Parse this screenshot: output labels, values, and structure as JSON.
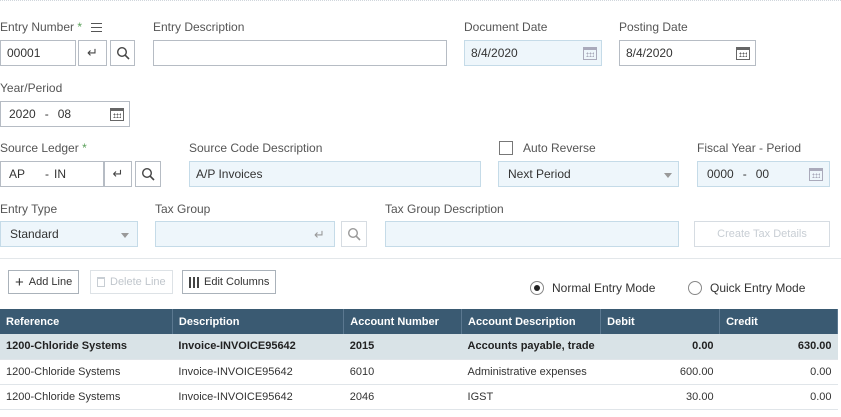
{
  "header_form": {
    "entry_number": {
      "label": "Entry Number",
      "required": "*",
      "value": "00001"
    },
    "entry_description": {
      "label": "Entry Description",
      "value": ""
    },
    "document_date": {
      "label": "Document Date",
      "value": "8/4/2020"
    },
    "posting_date": {
      "label": "Posting Date",
      "value": "8/4/2020"
    },
    "year_period": {
      "label": "Year/Period",
      "year": "2020",
      "sep": "-",
      "period": "08"
    },
    "source_ledger": {
      "label": "Source Ledger",
      "required": "*",
      "ledger": "AP",
      "sep": "-",
      "code": "IN"
    },
    "source_code_description": {
      "label": "Source Code Description",
      "value": "A/P Invoices"
    },
    "auto_reverse": {
      "label": "Auto Reverse",
      "checked": false,
      "option": "Next Period"
    },
    "fiscal_year_period": {
      "label": "Fiscal Year - Period",
      "year": "0000",
      "sep": "-",
      "period": "00"
    },
    "entry_type": {
      "label": "Entry Type",
      "value": "Standard"
    },
    "tax_group": {
      "label": "Tax Group",
      "value": ""
    },
    "tax_group_description": {
      "label": "Tax Group Description",
      "value": ""
    },
    "create_tax_details": {
      "label": "Create Tax Details"
    }
  },
  "toolbar": {
    "add_line": "Add Line",
    "delete_line": "Delete Line",
    "edit_columns": "Edit Columns",
    "normal_mode": "Normal Entry Mode",
    "quick_mode": "Quick Entry Mode",
    "selected_mode": "normal"
  },
  "grid": {
    "columns": [
      "Reference",
      "Description",
      "Account Number",
      "Account Description",
      "Debit",
      "Credit"
    ],
    "rows": [
      {
        "reference": "1200-Chloride Systems",
        "description": "Invoice-INVOICE95642",
        "account_number": "2015",
        "account_description": "Accounts payable, trade",
        "debit": "0.00",
        "credit": "630.00"
      },
      {
        "reference": "1200-Chloride Systems",
        "description": "Invoice-INVOICE95642",
        "account_number": "6010",
        "account_description": "Administrative expenses",
        "debit": "600.00",
        "credit": "0.00"
      },
      {
        "reference": "1200-Chloride Systems",
        "description": "Invoice-INVOICE95642",
        "account_number": "2046",
        "account_description": "IGST",
        "debit": "30.00",
        "credit": "0.00"
      }
    ]
  },
  "colors": {
    "grid_header": "#3a5a72",
    "selected_row": "#d9e3e7",
    "required_mark": "#5aa05a",
    "readonly_field": "#eef6fb"
  }
}
